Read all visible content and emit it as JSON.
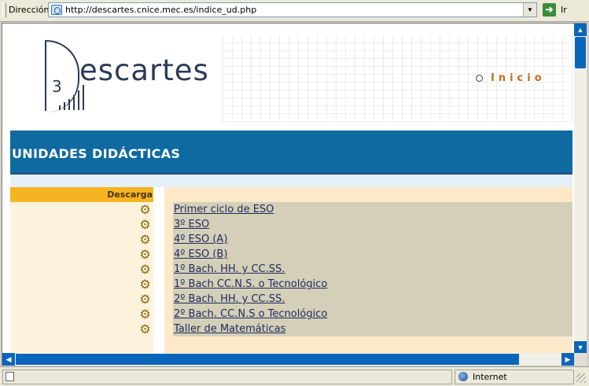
{
  "addressbar": {
    "label": "Dirección",
    "url": "http://descartes.cnice.mec.es/indice_ud.php",
    "go_label": "Ir"
  },
  "banner": {
    "logo_digit": "3",
    "logo_text": "escartes",
    "inicio_label": "Inicio"
  },
  "title": "UNIDADES DIDÁCTICAS",
  "download_header": "Descarga",
  "download_icon": "gear-icon",
  "units": [
    "Primer ciclo de ESO",
    "3º ESO",
    "4º ESO (A)",
    "4º ESO (B)",
    "1º Bach. HH. y CC.SS.",
    "1º Bach CC.N.S. o Tecnológico",
    "2º Bach. HH. y CC.SS.",
    "2º Bach. CC.N.S o Tecnológico",
    "Taller de Matemáticas"
  ],
  "statusbar": {
    "zone": "Internet"
  },
  "colors": {
    "title_bar": "#0f6aa1",
    "download_header": "#f5b523",
    "list_bg": "#d4cfb9",
    "link": "#1e2a5a",
    "inicio": "#c86a1a"
  }
}
